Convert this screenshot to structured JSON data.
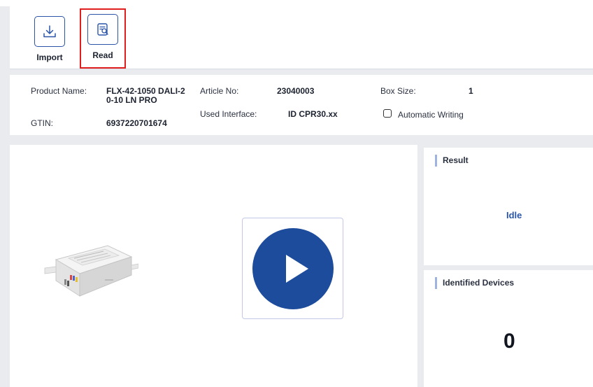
{
  "toolbar": {
    "import_label": "Import",
    "read_label": "Read"
  },
  "info": {
    "product_name_key": "Product Name:",
    "product_name_line1": "FLX-42-1050 DALI-2",
    "product_name_line2": "0-10 LN PRO",
    "gtin_key": "GTIN:",
    "gtin_value": "6937220701674",
    "article_no_key": "Article No:",
    "article_no_value": "23040003",
    "used_interface_key": "Used Interface:",
    "used_interface_value": "ID CPR30.xx",
    "box_size_key": "Box Size:",
    "box_size_value": "1",
    "automatic_writing_label": "Automatic Writing",
    "automatic_writing_checked": false
  },
  "result": {
    "title": "Result",
    "status": "Idle"
  },
  "devices": {
    "title": "Identified Devices",
    "count": "0"
  },
  "colors": {
    "accent": "#1e4c9c",
    "highlight_border": "#e01e1e",
    "status_text": "#2b55a8"
  },
  "icons": {
    "import": "download-icon",
    "read": "document-search-icon",
    "play": "play-icon"
  }
}
